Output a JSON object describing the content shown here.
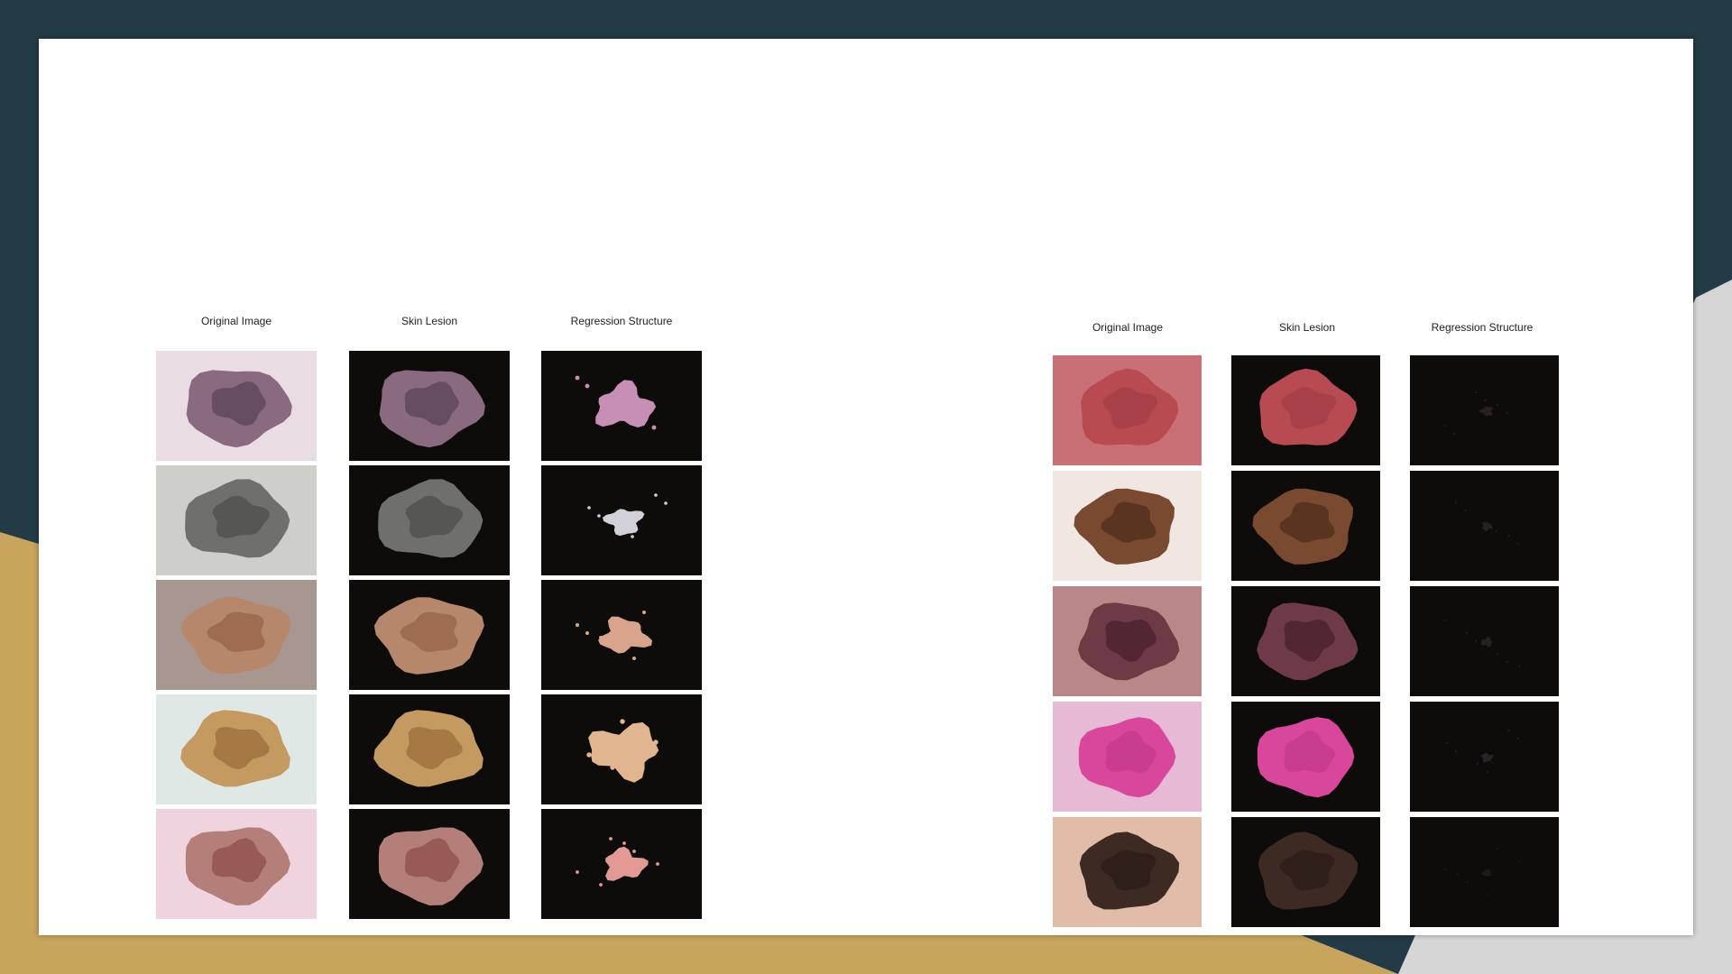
{
  "colors": {
    "background": "#233a47",
    "accent_gold": "#c8a45c",
    "accent_gray": "#d6d6d6",
    "slide": "#ffffff"
  },
  "left_panel": {
    "headers": [
      "Original Image",
      "Skin Lesion",
      "Regression Structure"
    ],
    "rows": [
      {
        "skin": "#e9dde3",
        "lesion": "#8a6a7e",
        "core": "#5a4458",
        "region": "#c78fb6",
        "region_frac": 0.45
      },
      {
        "skin": "#cfcfc9",
        "lesion": "#6f706c",
        "core": "#4d4e4b",
        "region": "#d2d0d8",
        "region_frac": 0.25
      },
      {
        "skin": "#a89690",
        "lesion": "#b6876a",
        "core": "#95634a",
        "region": "#d8a58c",
        "region_frac": 0.35
      },
      {
        "skin": "#dfe8e4",
        "lesion": "#c49a60",
        "core": "#9c6c3a",
        "region": "#e0b58f",
        "region_frac": 0.55
      },
      {
        "skin": "#efd3df",
        "lesion": "#b37f78",
        "core": "#8d4e4a",
        "region": "#e39a95",
        "region_frac": 0.3
      }
    ]
  },
  "right_panel": {
    "headers": [
      "Original Image",
      "Skin Lesion",
      "Regression Structure"
    ],
    "rows": [
      {
        "skin": "#c97077",
        "lesion": "#b84a52",
        "core": "#a33e47",
        "region": "#2a2022",
        "region_frac": 0.05
      },
      {
        "skin": "#f0e7e2",
        "lesion": "#7a4a30",
        "core": "#4f2d1c",
        "region": "#222",
        "region_frac": 0.03
      },
      {
        "skin": "#b98787",
        "lesion": "#6d3a45",
        "core": "#4a222c",
        "region": "#262022",
        "region_frac": 0.04
      },
      {
        "skin": "#e6b9d4",
        "lesion": "#d8479c",
        "core": "#c43a8a",
        "region": "#2a2228",
        "region_frac": 0.04
      },
      {
        "skin": "#e0bca9",
        "lesion": "#3d2a22",
        "core": "#2a1c16",
        "region": "#1e1a18",
        "region_frac": 0.02
      }
    ]
  }
}
